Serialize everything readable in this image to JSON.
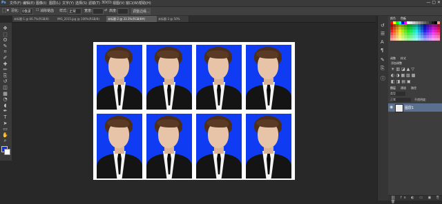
{
  "menubar": {
    "logo": "Ps",
    "items": [
      "文件(F)",
      "编辑(E)",
      "图像(I)",
      "图层(L)",
      "文字(Y)",
      "选择(S)",
      "滤镜(T)",
      "3D(D)",
      "视图(V)",
      "窗口(W)",
      "帮助(H)"
    ],
    "window_controls": "— ▢ ✕"
  },
  "options": {
    "feather_label": "羽化:",
    "feather_value": "0像素",
    "antialias_label": "消除锯齿",
    "style_label": "样式:",
    "style_value": "正常",
    "width_label": "宽度:",
    "height_label": "高度:",
    "refine_edge_label": "调整边缘..."
  },
  "tabs": [
    {
      "label": "未标题-1 @ 66.7%(RGB/8)",
      "active": false
    },
    {
      "label": "IMG_2015.jpg @ 100%(RGB/8)",
      "active": false
    },
    {
      "label": "未标题-2 @ 33.3%(RGB/8#)",
      "active": true
    },
    {
      "label": "未标题-3 @ 50%",
      "active": false
    }
  ],
  "tools": [
    "move-tool",
    "marquee-tool",
    "lasso-tool",
    "quick-select-tool",
    "crop-tool",
    "eyedropper-tool",
    "healing-tool",
    "brush-tool",
    "clone-stamp-tool",
    "history-brush-tool",
    "eraser-tool",
    "gradient-tool",
    "blur-tool",
    "dodge-tool",
    "pen-tool",
    "type-tool",
    "path-select-tool",
    "shape-tool",
    "hand-tool",
    "zoom-tool"
  ],
  "tool_glyphs": [
    "✥",
    "⬚",
    "ʘ",
    "✎",
    "⌗",
    "✐",
    "✚",
    "✏",
    "⎘",
    "↺",
    "◫",
    "▦",
    "◔",
    "◖",
    "✒",
    "T",
    "➤",
    "▭",
    "✋",
    "⌕"
  ],
  "colors": {
    "foreground": "#0033ff",
    "background": "#ffffff",
    "photo_bg": "#0f3cf2"
  },
  "document": {
    "rows": 2,
    "cols": 4
  },
  "panels": {
    "color_tab": "颜色",
    "swatches_tab": "色板",
    "adjust_tab": "调整",
    "styles_tab": "样式",
    "add_adjust_label": "添加调整",
    "layers_tab": "图层",
    "channels_tab": "通道",
    "paths_tab": "路径",
    "layer_kind": "类型",
    "blend_mode": "正常",
    "opacity_label": "不透明度:",
    "fill_label": "填充:",
    "lock_label": "锁定:",
    "layer_name": "图层1"
  }
}
